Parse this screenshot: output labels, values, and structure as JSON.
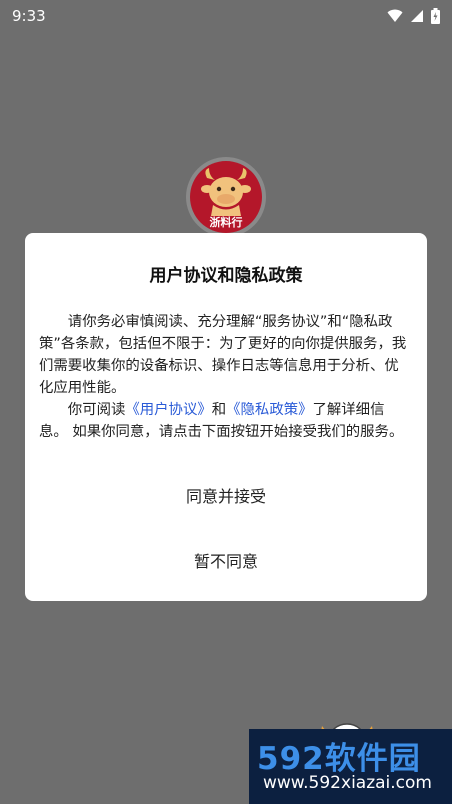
{
  "status_bar": {
    "time": "9:33",
    "icons": [
      "wifi-icon",
      "signal-icon",
      "battery-icon"
    ]
  },
  "logo": {
    "text": "浙料行"
  },
  "dialog": {
    "title": "用户协议和隐私政策",
    "paragraph1": "请你务必审慎阅读、充分理解“服务协议”和“隐私政策”各条款，包括但不限于：为了更好的向你提供服务，我们需要收集你的设备标识、操作日志等信息用于分析、优化应用性能。",
    "paragraph2_prefix": "你可阅读",
    "user_agreement_link": "《用户协议》",
    "and": "和",
    "privacy_policy_link": "《隐私政策》",
    "paragraph2_suffix": "了解详细信息。  如果你同意，请点击下面按钮开始接受我们的服务。",
    "agree_button": "同意并接受",
    "disagree_button": "暂不同意"
  },
  "watermark": {
    "line1": "592软件园",
    "line2": "www.592xiazai.com"
  },
  "colors": {
    "overlay": "#6e6e6e",
    "link": "#2a5bd7",
    "logo_red": "#b4172a",
    "watermark_bg": "#0c2040",
    "watermark_blue": "#3d8fe8"
  }
}
